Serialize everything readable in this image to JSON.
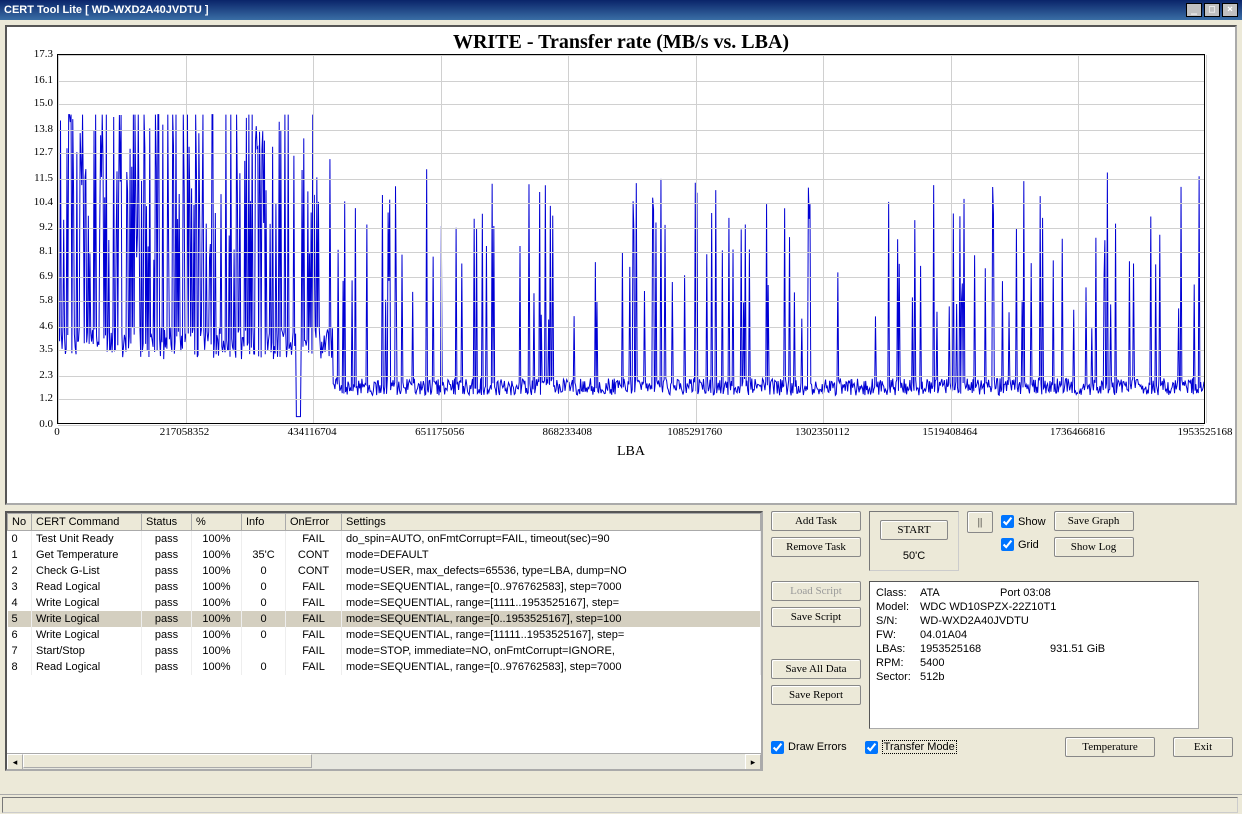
{
  "window": {
    "title": "CERT Tool Lite [ WD-WXD2A40JVDTU ]"
  },
  "chart_data": {
    "type": "line",
    "title": "WRITE - Transfer rate (MB/s vs. LBA)",
    "xlabel": "LBA",
    "ylabel": "",
    "ylim": [
      0,
      17.3
    ],
    "xlim": [
      0,
      1953525168
    ],
    "y_ticks": [
      "0.0",
      "1.2",
      "2.3",
      "3.5",
      "4.6",
      "5.8",
      "6.9",
      "8.1",
      "9.2",
      "10.4",
      "11.5",
      "12.7",
      "13.8",
      "15.0",
      "16.1",
      "17.3"
    ],
    "x_ticks": [
      "0",
      "217058352",
      "434116704",
      "651175056",
      "868233408",
      "1085291760",
      "1302350112",
      "1519408464",
      "1736466816",
      "1953525168"
    ],
    "description": "Noisy write transfer rate across full LBA range. First ~25% of LBA span has peaks frequently reaching 8–13 MB/s with baseline ~2–4 MB/s. After ~434M LBA the baseline drops to ~1–2 MB/s with occasional spikes to 6–10 MB/s throughout the remainder. One low dip near 0 around LBA ~400M."
  },
  "table": {
    "headers": [
      "No",
      "CERT Command",
      "Status",
      "%",
      "Info",
      "OnError",
      "Settings"
    ],
    "selected_index": 5,
    "rows": [
      {
        "no": "0",
        "cmd": "Test Unit Ready",
        "status": "pass",
        "pct": "100%",
        "info": "",
        "onerr": "FAIL",
        "settings": "do_spin=AUTO, onFmtCorrupt=FAIL, timeout(sec)=90"
      },
      {
        "no": "1",
        "cmd": "Get Temperature",
        "status": "pass",
        "pct": "100%",
        "info": "35'C",
        "onerr": "CONT",
        "settings": "mode=DEFAULT"
      },
      {
        "no": "2",
        "cmd": "Check G-List",
        "status": "pass",
        "pct": "100%",
        "info": "0",
        "onerr": "CONT",
        "settings": "mode=USER, max_defects=65536, type=LBA, dump=NO"
      },
      {
        "no": "3",
        "cmd": "Read Logical",
        "status": "pass",
        "pct": "100%",
        "info": "0",
        "onerr": "FAIL",
        "settings": "mode=SEQUENTIAL, range=[0..976762583], step=7000"
      },
      {
        "no": "4",
        "cmd": "Write Logical",
        "status": "pass",
        "pct": "100%",
        "info": "0",
        "onerr": "FAIL",
        "settings": "mode=SEQUENTIAL, range=[1111..1953525167], step="
      },
      {
        "no": "5",
        "cmd": "Write Logical",
        "status": "pass",
        "pct": "100%",
        "info": "0",
        "onerr": "FAIL",
        "settings": "mode=SEQUENTIAL, range=[0..1953525167], step=100"
      },
      {
        "no": "6",
        "cmd": "Write Logical",
        "status": "pass",
        "pct": "100%",
        "info": "0",
        "onerr": "FAIL",
        "settings": "mode=SEQUENTIAL, range=[11111..1953525167], step="
      },
      {
        "no": "7",
        "cmd": "Start/Stop",
        "status": "pass",
        "pct": "100%",
        "info": "",
        "onerr": "FAIL",
        "settings": "mode=STOP, immediate=NO, onFmtCorrupt=IGNORE, "
      },
      {
        "no": "8",
        "cmd": "Read Logical",
        "status": "pass",
        "pct": "100%",
        "info": "0",
        "onerr": "FAIL",
        "settings": "mode=SEQUENTIAL, range=[0..976762583], step=7000"
      }
    ]
  },
  "buttons": {
    "add_task": "Add Task",
    "remove_task": "Remove Task",
    "start": "START",
    "pause": "||",
    "load_script": "Load Script",
    "save_script": "Save Script",
    "save_all_data": "Save All Data",
    "save_report": "Save Report",
    "save_graph": "Save Graph",
    "show_log": "Show Log",
    "temperature": "Temperature",
    "exit": "Exit"
  },
  "checkboxes": {
    "show": "Show",
    "grid": "Grid",
    "draw_errors": "Draw Errors",
    "transfer_mode": "Transfer Mode"
  },
  "temp_label": "50'C",
  "drive_info": {
    "class_label": "Class:",
    "class_val": "ATA",
    "port_label": "Port 03:08",
    "model_label": "Model:",
    "model_val": "WDC WD10SPZX-22Z10T1",
    "sn_label": "S/N:",
    "sn_val": "WD-WXD2A40JVDTU",
    "fw_label": "FW:",
    "fw_val": "04.01A04",
    "lbas_label": "LBAs:",
    "lbas_val": "1953525168",
    "cap_val": "931.51 GiB",
    "rpm_label": "RPM:",
    "rpm_val": "5400",
    "sector_label": "Sector:",
    "sector_val": "512b"
  }
}
